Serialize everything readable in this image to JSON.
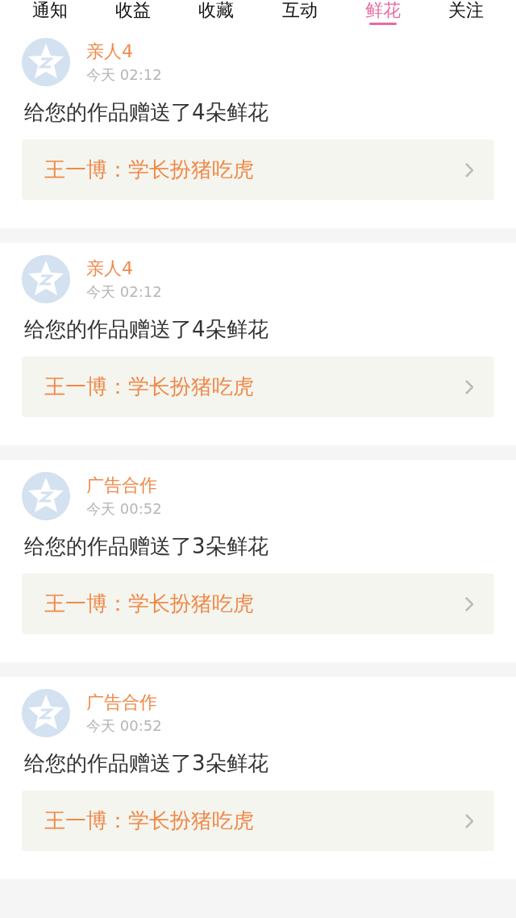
{
  "tabs": [
    {
      "label": "通知",
      "selected": false
    },
    {
      "label": "收益",
      "selected": false
    },
    {
      "label": "收藏",
      "selected": false
    },
    {
      "label": "互动",
      "selected": false
    },
    {
      "label": "鲜花",
      "selected": true
    },
    {
      "label": "关注",
      "selected": false
    }
  ],
  "messages": [
    {
      "sender": "亲人4",
      "time": "今天 02:12",
      "text": "给您的作品赠送了4朵鲜花",
      "work": "王一博：学长扮猪吃虎"
    },
    {
      "sender": "亲人4",
      "time": "今天 02:12",
      "text": "给您的作品赠送了4朵鲜花",
      "work": "王一博：学长扮猪吃虎"
    },
    {
      "sender": "广告合作",
      "time": "今天 00:52",
      "text": "给您的作品赠送了3朵鲜花",
      "work": "王一博：学长扮猪吃虎"
    },
    {
      "sender": "广告合作",
      "time": "今天 00:52",
      "text": "给您的作品赠送了3朵鲜花",
      "work": "王一博：学长扮猪吃虎"
    }
  ]
}
